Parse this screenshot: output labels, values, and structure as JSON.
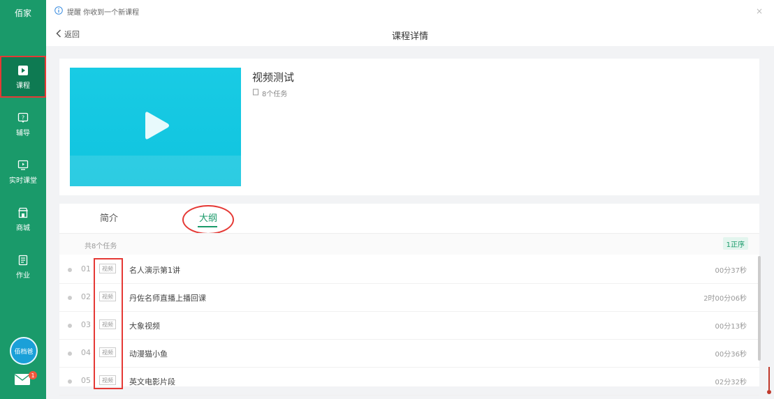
{
  "sidebar": {
    "brand": "佰家",
    "items": [
      {
        "label": "课程",
        "icon": "play-square-icon"
      },
      {
        "label": "辅导",
        "icon": "question-icon"
      },
      {
        "label": "实时课堂",
        "icon": "live-class-icon"
      },
      {
        "label": "商城",
        "icon": "store-icon"
      },
      {
        "label": "作业",
        "icon": "homework-icon"
      }
    ],
    "avatar_text": "佰档爸",
    "mail_badge": "1"
  },
  "notice": {
    "text": "提醒 你收到一个新课程"
  },
  "header": {
    "back_label": "返回",
    "title": "课程详情"
  },
  "course": {
    "title": "视频测试",
    "task_count": "8个任务"
  },
  "tabs": [
    {
      "label": "简介"
    },
    {
      "label": "大纲"
    }
  ],
  "outline": {
    "summary": "共8个任务",
    "order_label": "1正序",
    "items": [
      {
        "num": "01",
        "tag": "视频",
        "name": "名人演示第1讲",
        "duration": "00分37秒"
      },
      {
        "num": "02",
        "tag": "视频",
        "name": "丹佐名师直播上播回课",
        "duration": "2时00分06秒"
      },
      {
        "num": "03",
        "tag": "视频",
        "name": "大象视频",
        "duration": "00分13秒"
      },
      {
        "num": "04",
        "tag": "视频",
        "name": "动漫猫小鱼",
        "duration": "00分36秒"
      },
      {
        "num": "05",
        "tag": "视频",
        "name": "英文电影片段",
        "duration": "02分32秒"
      }
    ]
  },
  "colors": {
    "sidebar": "#1a9a6a",
    "accent": "#1a9a6a",
    "cover": "#16c8e2",
    "annotation": "#e53935"
  }
}
